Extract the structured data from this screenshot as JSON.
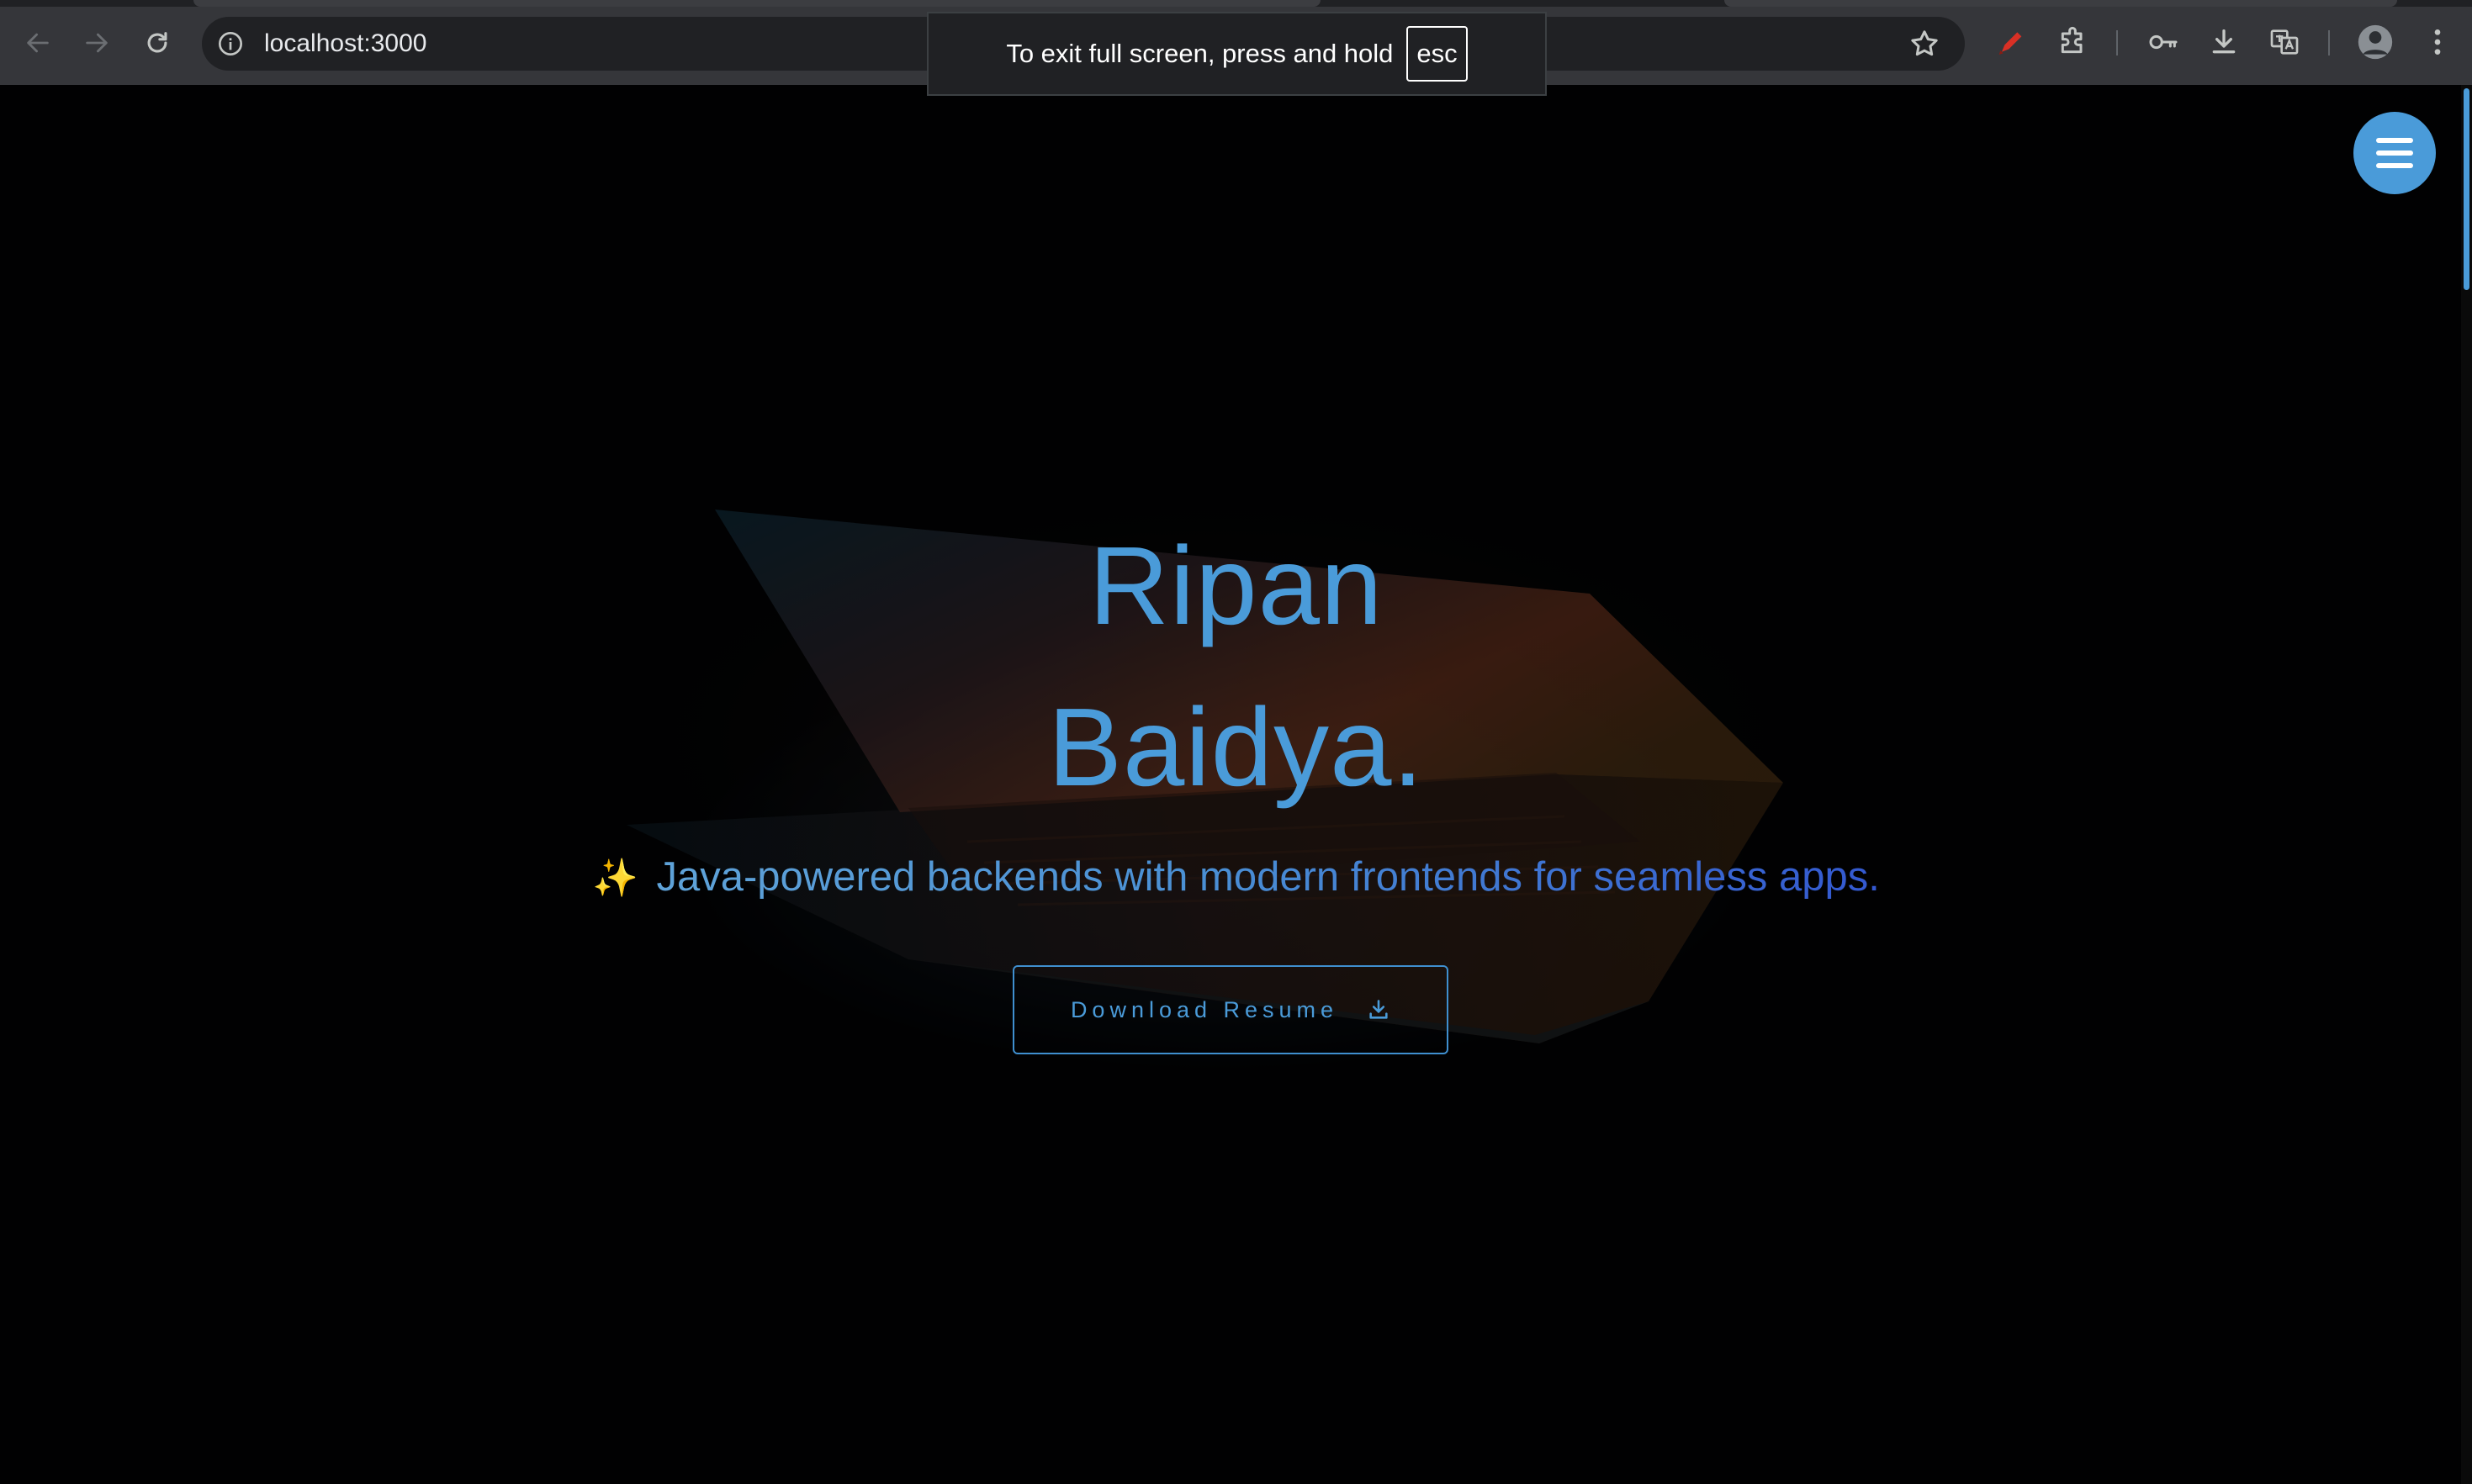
{
  "browser": {
    "url": "localhost:3000",
    "fullscreen_toast": {
      "message": "To exit full screen, press and hold",
      "key": "esc"
    }
  },
  "hero": {
    "first_name": "Ripan",
    "last_name": "Baidya.",
    "tagline_icon": "✨",
    "tagline": "Java-powered backends with modern frontends for seamless apps.",
    "resume_button_label": "Download Resume"
  },
  "colors": {
    "accent": "#4a9bd9",
    "tagline_end": "#3358d0",
    "chrome_bg": "#35363a"
  },
  "icons": {
    "back": "back-arrow-icon",
    "forward": "forward-arrow-icon",
    "reload": "reload-icon",
    "site_info": "site-info-icon",
    "bookmark": "star-icon",
    "menu": "hamburger-menu-icon",
    "download_resume": "download-icon"
  }
}
